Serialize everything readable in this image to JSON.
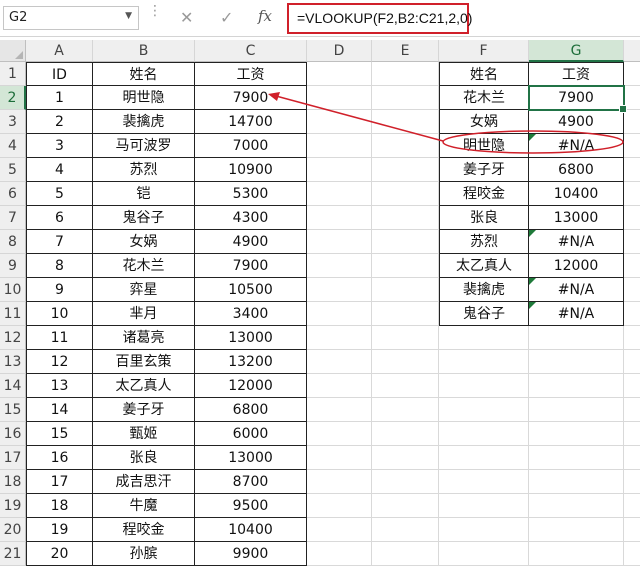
{
  "name_box": {
    "value": "G2"
  },
  "formula_bar": {
    "cancel_icon": "✕",
    "enter_icon": "✓",
    "fx_label": "fx",
    "formula": "=VLOOKUP(F2,B2:C21,2,0)"
  },
  "columns": [
    "A",
    "B",
    "C",
    "D",
    "E",
    "F",
    "G"
  ],
  "rows": [
    "1",
    "2",
    "3",
    "4",
    "5",
    "6",
    "7",
    "8",
    "9",
    "10",
    "11",
    "12",
    "13",
    "14",
    "15",
    "16",
    "17",
    "18",
    "19",
    "20",
    "21"
  ],
  "selected_cell": "G2",
  "left_table": {
    "headers": [
      "ID",
      "姓名",
      "工资"
    ],
    "rows": [
      [
        "1",
        "明世隐",
        "7900"
      ],
      [
        "2",
        "裴擒虎",
        "14700"
      ],
      [
        "3",
        "马可波罗",
        "7000"
      ],
      [
        "4",
        "苏烈",
        "10900"
      ],
      [
        "5",
        "铠",
        "5300"
      ],
      [
        "6",
        "鬼谷子",
        "4300"
      ],
      [
        "7",
        "女娲",
        "4900"
      ],
      [
        "8",
        "花木兰",
        "7900"
      ],
      [
        "9",
        "弈星",
        "10500"
      ],
      [
        "10",
        "芈月",
        "3400"
      ],
      [
        "11",
        "诸葛亮",
        "13000"
      ],
      [
        "12",
        "百里玄策",
        "13200"
      ],
      [
        "13",
        "太乙真人",
        "12000"
      ],
      [
        "14",
        "姜子牙",
        "6800"
      ],
      [
        "15",
        "甄姬",
        "6000"
      ],
      [
        "16",
        "张良",
        "13000"
      ],
      [
        "17",
        "成吉思汗",
        "8700"
      ],
      [
        "18",
        "牛魔",
        "9500"
      ],
      [
        "19",
        "程咬金",
        "10400"
      ],
      [
        "20",
        "孙膑",
        "9900"
      ]
    ]
  },
  "right_table": {
    "headers": [
      "姓名",
      "工资"
    ],
    "rows": [
      [
        "花木兰",
        "7900",
        false
      ],
      [
        "女娲",
        "4900",
        false
      ],
      [
        "明世隐",
        "#N/A",
        true
      ],
      [
        "姜子牙",
        "6800",
        false
      ],
      [
        "程咬金",
        "10400",
        false
      ],
      [
        "张良",
        "13000",
        false
      ],
      [
        "苏烈",
        "#N/A",
        true
      ],
      [
        "太乙真人",
        "12000",
        false
      ],
      [
        "裴擒虎",
        "#N/A",
        true
      ],
      [
        "鬼谷子",
        "#N/A",
        true
      ]
    ]
  },
  "annotation_color": "#d0202a",
  "accent_color": "#217346"
}
